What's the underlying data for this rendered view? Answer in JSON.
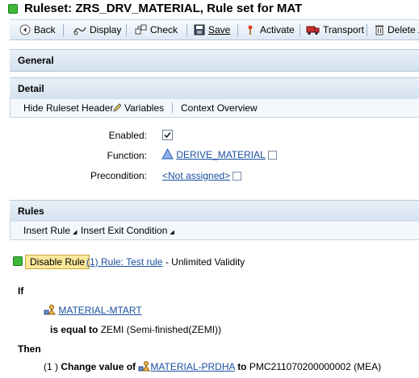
{
  "title": {
    "text": "Ruleset: ZRS_DRV_MATERIAL, Rule set for MAT"
  },
  "toolbar": {
    "back": "Back",
    "display": "Display",
    "check": "Check",
    "save": "Save",
    "activate": "Activate",
    "transport": "Transport",
    "delete": "Delete"
  },
  "sections": {
    "general": "General",
    "detail": "Detail",
    "rules": "Rules"
  },
  "detail_bar": {
    "hide": "Hide Ruleset Header",
    "variables": "Variables",
    "context": "Context Overview"
  },
  "form": {
    "enabled_label": "Enabled:",
    "function_label": "Function:",
    "function_value": "DERIVE_MATERIAL",
    "precondition_label": "Precondition:",
    "precondition_value": "<Not assigned>"
  },
  "rules_bar": {
    "insert_rule": "Insert Rule",
    "insert_exit": "Insert Exit Condition"
  },
  "rule": {
    "disable_button": "Disable Rule",
    "link": "(1) Rule: Test rule",
    "validity": "- Unlimited Validity",
    "if_label": "If",
    "condition_field": "MATERIAL-MTART",
    "operator": "is equal to",
    "condition_value": "ZEMI (Semi-finished(ZEMI))",
    "then_label": "Then",
    "action_index": "(1 )",
    "action_text": "Change value of",
    "action_field": "MATERIAL-PRDHA",
    "to_label": "to",
    "action_value": "PMC211070200000002 (MEA)"
  }
}
